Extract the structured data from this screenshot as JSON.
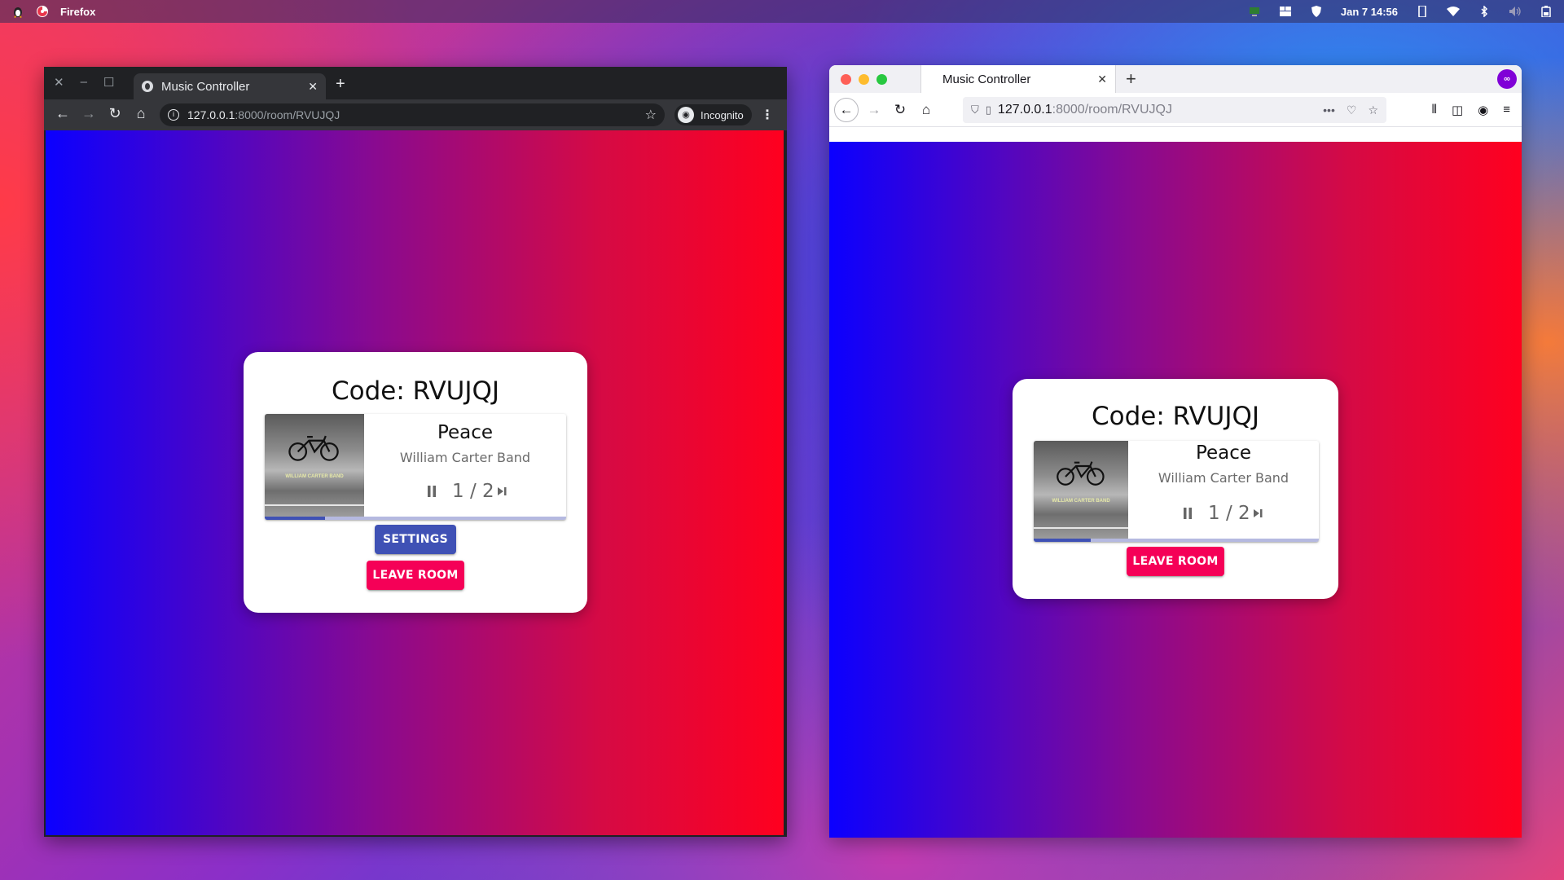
{
  "topbar": {
    "app_name": "Firefox",
    "clock": "Jan 7 14:56",
    "icons": [
      "tux-icon",
      "firefox-icon",
      "monitor-icon",
      "windows-icon",
      "shield-icon",
      "phone-icon",
      "wifi-icon",
      "bluetooth-icon",
      "volume-icon",
      "battery-icon"
    ]
  },
  "chrome": {
    "tab_title": "Music Controller",
    "url_host": "127.0.0.1",
    "url_path": ":8000/room/RVUJQJ",
    "incognito_label": "Incognito"
  },
  "firefox": {
    "tab_title": "Music Controller",
    "url_host": "127.0.0.1",
    "url_path": ":8000/room/RVUJQJ"
  },
  "room": {
    "code_label": "Code: RVUJQJ",
    "song": {
      "title": "Peace",
      "artist": "William Carter Band",
      "votes": "1 / 2",
      "progress": 0.2,
      "cover_text": "WILLIAM CARTER BAND"
    },
    "settings_label": "Settings",
    "leave_label": "Leave Room"
  },
  "colors": {
    "primary": "#3f51b5",
    "secondary": "#f50057",
    "gradient_left": "#0b00ff",
    "gradient_right": "#ff001f"
  }
}
